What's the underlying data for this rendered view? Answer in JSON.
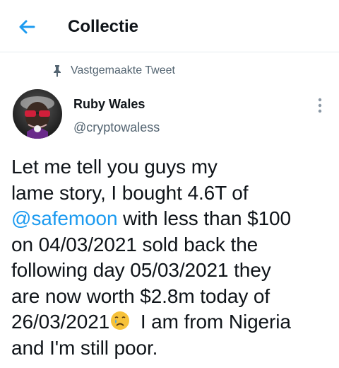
{
  "header": {
    "back_icon": "arrow-left-icon",
    "title": "Collectie"
  },
  "pinned": {
    "icon": "pin-icon",
    "label": "Vastgemaakte Tweet"
  },
  "tweet": {
    "author": {
      "name": "Ruby Wales",
      "handle": "@cryptowaless",
      "avatar_icon": "avatar"
    },
    "more_icon": "more-vertical-icon",
    "lines": {
      "l1": "Let me tell you guys my",
      "l2": "lame story, I bought 4.6T of",
      "l3_mention": "@safemoon",
      "l3_rest": " with less than $100",
      "l4": "on 04/03/2021 sold back the",
      "l5": "following day 05/03/2021 they",
      "l6": "are now worth $2.8m today of",
      "l7_start": "26/03/2021",
      "l7_emoji": "crying-face-emoji",
      "l7_end": " I am from Nigeria",
      "l8": "and I'm still poor."
    }
  },
  "colors": {
    "accent": "#1d9bf0",
    "text_primary": "#0f1419",
    "text_secondary": "#536471",
    "divider": "#e6ecf0"
  }
}
